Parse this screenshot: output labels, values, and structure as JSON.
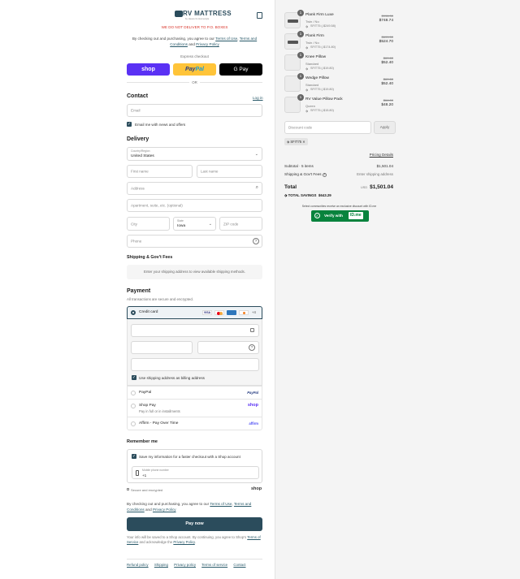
{
  "header": {
    "logo_text": "RV MATTRESS",
    "logo_tagline": "by Heaven's Homestyle",
    "warning": "WE DO NOT DELIVER TO P.O. BOXES",
    "agree_prefix": "By checking out and purchasing, you agree to our",
    "terms_of_use": "Terms of Use",
    "terms_conditions": "Terms and Conditions",
    "and": "and",
    "privacy_policy": "Privacy Policy"
  },
  "express": {
    "label": "Express checkout",
    "shop": "shop",
    "paypal_pay": "Pay",
    "paypal_pal": "Pal",
    "gpay": "G Pay",
    "or": "OR"
  },
  "contact": {
    "title": "Contact",
    "login": "Log in",
    "email_placeholder": "Email",
    "news_label": "Email me with news and offers"
  },
  "delivery": {
    "title": "Delivery",
    "country_label": "Country/Region",
    "country_value": "United States",
    "first_name": "First name",
    "last_name": "Last name",
    "address": "Address",
    "apartment": "Apartment, suite, etc. (optional)",
    "city": "City",
    "state_label": "State",
    "state_value": "Iowa",
    "zip": "ZIP code",
    "phone": "Phone"
  },
  "shipping": {
    "title": "Shipping & Gov't Fees",
    "message": "Enter your shipping address to view available shipping methods."
  },
  "payment": {
    "title": "Payment",
    "subtitle": "All transactions are secure and encrypted.",
    "credit_card": "Credit card",
    "card_more": "+4",
    "billing_same": "Use shipping address as billing address",
    "paypal": "PayPal",
    "paypal_logo": "PayPal",
    "shop_pay": "Shop Pay",
    "shop_pay_sub": "Pay in full or in installments",
    "shop_pay_logo": "shop",
    "affirm": "Affirm - Pay Over Time",
    "affirm_logo": "affirm"
  },
  "remember": {
    "title": "Remember me",
    "save_label": "Save my information for a faster checkout with a Shop account",
    "mobile_label": "Mobile phone number",
    "mobile_value": "+1",
    "secure": "Secure and encrypted",
    "shop_logo": "shop"
  },
  "bottom": {
    "agree_prefix": "By checking out and purchasing, you agree to our",
    "terms_of_use": "Terms of Use",
    "terms_conditions": "Terms and Conditions",
    "and": "and",
    "privacy_policy": "Privacy Policy",
    "pay_now": "Pay now",
    "info_text": "Your info will be saved to a Shop account. By continuing, you agree to Shop's",
    "tos": "Terms of Service",
    "ack": "and acknowledge the",
    "privacy": "Privacy Policy"
  },
  "footer": {
    "links": [
      "Refund policy",
      "Shipping",
      "Privacy policy",
      "Terms of service",
      "Contact"
    ]
  },
  "cart": {
    "items": [
      {
        "qty": "1",
        "name": "Plank Firm Luxe",
        "variant": "Twin / No",
        "code": "SFIT75 (-$249.58)",
        "original": "$998.30",
        "price": "$748.74"
      },
      {
        "qty": "1",
        "name": "Plank Firm",
        "variant": "Twin / No",
        "code": "SFIT75 (-$174.80)",
        "original": "$699.50",
        "price": "$524.70"
      },
      {
        "qty": "1",
        "name": "Knee Pillow",
        "variant": "Standard",
        "code": "SFIT75 (-$19.80)",
        "original": "$69.60",
        "price": "$52.40"
      },
      {
        "qty": "1",
        "name": "Wedge Pillow",
        "variant": "Standard",
        "code": "SFIT75 (-$19.80)",
        "original": "$69.60",
        "price": "$52.40"
      },
      {
        "qty": "1",
        "name": "RV Value Pillow Pack",
        "variant": "Queen",
        "code": "SFIT75 (-$15.80)",
        "original": "$64.00",
        "price": "$48.20"
      }
    ],
    "discount_placeholder": "Discount code",
    "apply": "Apply",
    "applied_code": "SFIT75",
    "pricing_details": "Pricing Details",
    "subtotal_label": "Subtotal · 5 items",
    "subtotal_value": "$1,501.04",
    "shipping_label": "Shipping & Gov't Fees",
    "shipping_value": "Enter shipping address",
    "total_label": "Total",
    "currency": "USD",
    "total_value": "$1,501.04",
    "savings_label": "TOTAL SAVINGS",
    "savings_value": "$643.29",
    "idme_note": "Select communities receive an exclusive discount with ID.me",
    "verify_label": "Verify with",
    "idme_logo": "ID.me"
  }
}
